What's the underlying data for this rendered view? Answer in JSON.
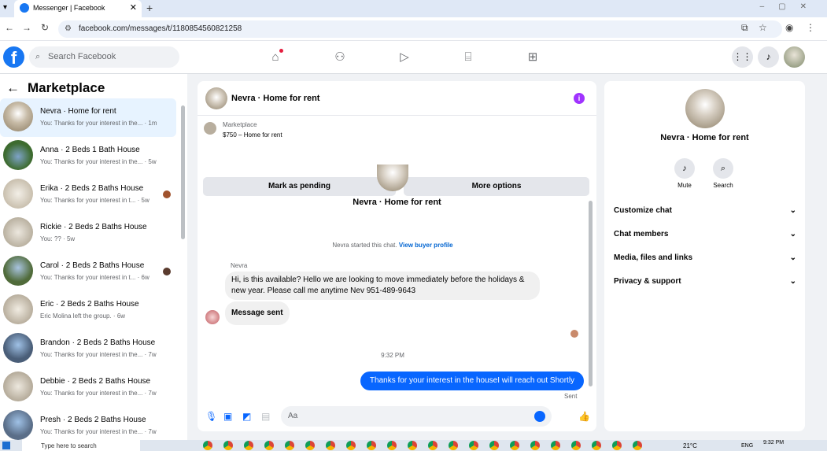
{
  "browser": {
    "tab_title": "Messenger | Facebook",
    "url": "facebook.com/messages/t/1180854560821258"
  },
  "fb_nav": {
    "search_placeholder": "Search Facebook",
    "icons": [
      "home-icon",
      "friends-icon",
      "video-icon",
      "marketplace-icon",
      "gaming-icon",
      "menu-icon",
      "notifications-icon",
      "profile-avatar"
    ]
  },
  "left": {
    "title": "Marketplace",
    "conversations": [
      {
        "name": "Nevra · Home for rent",
        "snippet": "You: Thanks for your interest in the... · 1m",
        "active": true
      },
      {
        "name": "Anna · 2 Beds 1 Bath House",
        "snippet": "You: Thanks for your interest in the... · 5w"
      },
      {
        "name": "Erika · 2 Beds 2 Baths House",
        "snippet": "You: Thanks for your interest in t... · 5w"
      },
      {
        "name": "Rickie · 2 Beds 2 Baths House",
        "snippet": "You: ?? · 5w"
      },
      {
        "name": "Carol · 2 Beds 2 Baths House",
        "snippet": "You: Thanks for your interest in t... · 6w"
      },
      {
        "name": "Eric · 2 Beds 2 Baths House",
        "snippet": "Eric Molina left the group. · 6w"
      },
      {
        "name": "Brandon · 2 Beds 2 Baths House",
        "snippet": "You: Thanks for your interest in the... · 7w"
      },
      {
        "name": "Debbie · 2 Beds 2 Baths House",
        "snippet": "You: Thanks for your interest in the... · 7w"
      },
      {
        "name": "Presh · 2 Beds 2 Baths House",
        "snippet": "You: Thanks for your interest in the... · 7w"
      }
    ]
  },
  "chat": {
    "header_title": "Nevra · Home for rent",
    "marketplace_label": "Marketplace",
    "listing": "$750 – Home for rent",
    "mark_pending": "Mark as pending",
    "more_options": "More options",
    "intro_name": "Nevra · Home for rent",
    "started_text": "Nevra started this chat.",
    "buyer_profile_link": "View buyer profile",
    "sender_name": "Nevra",
    "msg1": "Hi, is this available? Hello we are looking to move immediately before the holidays & new year. Please call me anytime Nev 951-489-9643",
    "msg2": "Message sent",
    "time": "9:32 PM",
    "msg3": "Thanks for your interest in the houseI will reach out Shortly",
    "sent_status": "Sent",
    "input_placeholder": "Aa"
  },
  "right": {
    "name": "Nevra · Home for rent",
    "mute": "Mute",
    "search": "Search",
    "sections": [
      "Customize chat",
      "Chat members",
      "Media, files and links",
      "Privacy & support"
    ]
  },
  "taskbar": {
    "search_placeholder": "Type here to search",
    "temp": "21°C",
    "lang": "ENG",
    "time": "9:32 PM",
    "date": ""
  }
}
